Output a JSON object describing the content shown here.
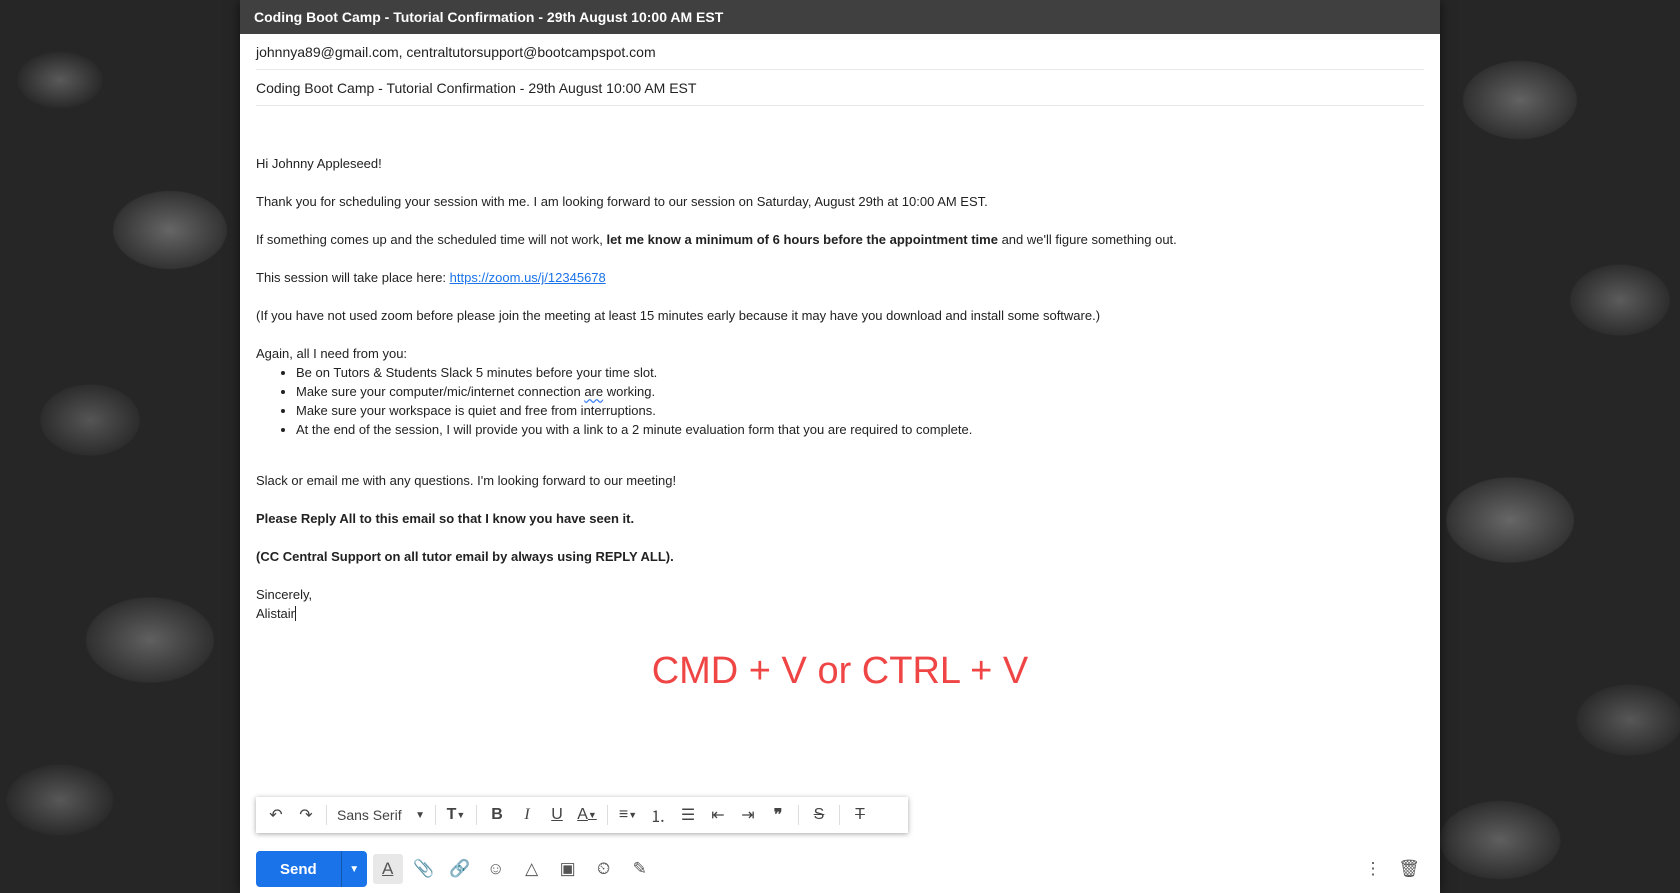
{
  "window": {
    "title": "Coding Boot Camp - Tutorial Confirmation - 29th August 10:00 AM EST"
  },
  "recipients": "johnnya89@gmail.com, centraltutorsupport@bootcampspot.com",
  "subject": "Coding Boot Camp - Tutorial Confirmation - 29th August 10:00 AM EST",
  "body": {
    "greeting": "Hi Johnny Appleseed!",
    "p1": "Thank you for scheduling your session with me. I am looking forward to our session on Saturday, August 29th at 10:00 AM EST.",
    "p2_pre": "If something comes up and the scheduled time will not work, ",
    "p2_bold": "let me know a minimum of 6 hours before the appointment time",
    "p2_post": " and we'll figure something out.",
    "p3_pre": "This session will take place here: ",
    "p3_link": "https://zoom.us/j/12345678",
    "p4": " (If you have not used zoom before please join the meeting at least 15 minutes early because it may have you download and install some software.)",
    "list_intro": "Again, all I need from you:",
    "items": [
      "Be on Tutors & Students Slack 5 minutes before your time slot.",
      "Make sure your computer/mic/internet connection ",
      "Make sure your workspace is quiet and free from interruptions.",
      "At the end of the session, I will provide you with a link to a 2 minute evaluation form that you are required to complete."
    ],
    "item2_flagged": "are",
    "item2_tail": " working.",
    "closing1": "Slack or email me with any questions. I'm looking forward to our meeting!",
    "bold1": "Please Reply All to this email so that I know you have seen it.",
    "bold2": "(CC Central Support on all tutor email by always using REPLY ALL).",
    "signoff": "Sincerely,",
    "name": "Alistair"
  },
  "hint": "CMD + V or CTRL + V",
  "toolbar": {
    "font": "Sans Serif"
  },
  "send_label": "Send"
}
